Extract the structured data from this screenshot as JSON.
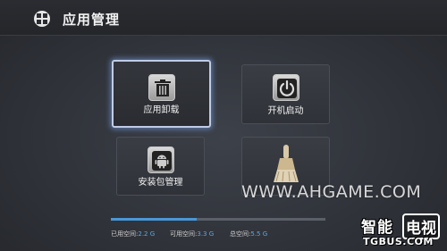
{
  "header": {
    "title": "应用管理",
    "icon": "app-grid-icon"
  },
  "tiles": [
    {
      "label": "应用卸载",
      "icon": "trash-icon",
      "focused": true
    },
    {
      "label": "开机启动",
      "icon": "power-icon",
      "focused": false
    },
    {
      "label": "安装包管理",
      "icon": "android-icon",
      "focused": false
    },
    {
      "label": "",
      "icon": "broom-icon",
      "focused": false
    }
  ],
  "storage": {
    "used_label": "已用空间:",
    "used_value": "2.2 G",
    "free_label": "可用空间:",
    "free_value": "3.3 G",
    "total_label": "总空间:",
    "total_value": "5.5 G",
    "used_fraction": 0.4
  },
  "watermark": "WWW.AHGAME.COM",
  "logo": {
    "cn_part1": "智能",
    "cn_part2": "电视",
    "en": "TGBUS.COM"
  },
  "colors": {
    "accent": "#4a97d8",
    "background": "#30333a"
  }
}
